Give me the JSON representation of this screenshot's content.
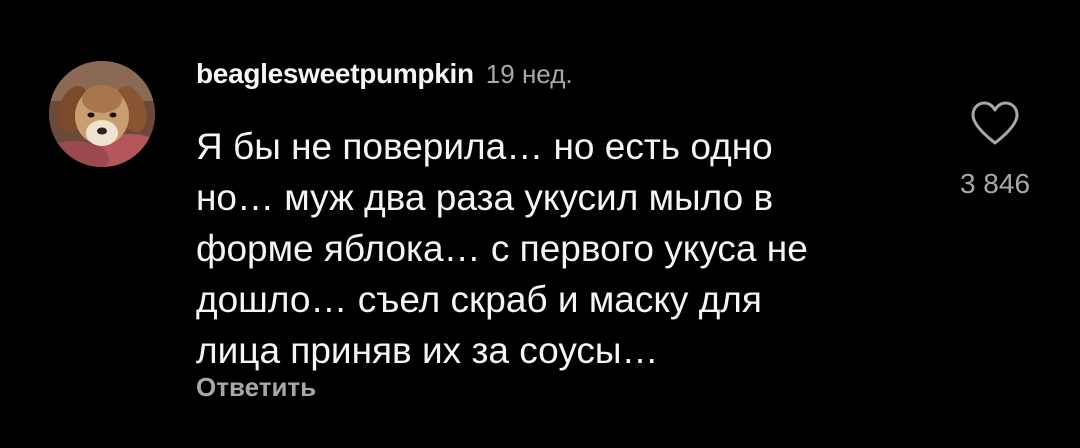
{
  "comment": {
    "username": "beaglesweetpumpkin",
    "time": "19 нед.",
    "text_lines": [
      "Я бы не поверила… но есть одно",
      "но… муж два раза укусил мыло в",
      "форме яблока… с первого укуса не",
      "дошло… съел скраб и маску для",
      "лица приняв их за соусы…"
    ],
    "reply_label": "Ответить",
    "like_count": "3 846",
    "avatar_icon": "dog-avatar",
    "like_icon": "heart-icon"
  },
  "colors": {
    "background": "#000000",
    "primary_text": "#f5f5f5",
    "secondary_text": "#a8a8a8"
  }
}
